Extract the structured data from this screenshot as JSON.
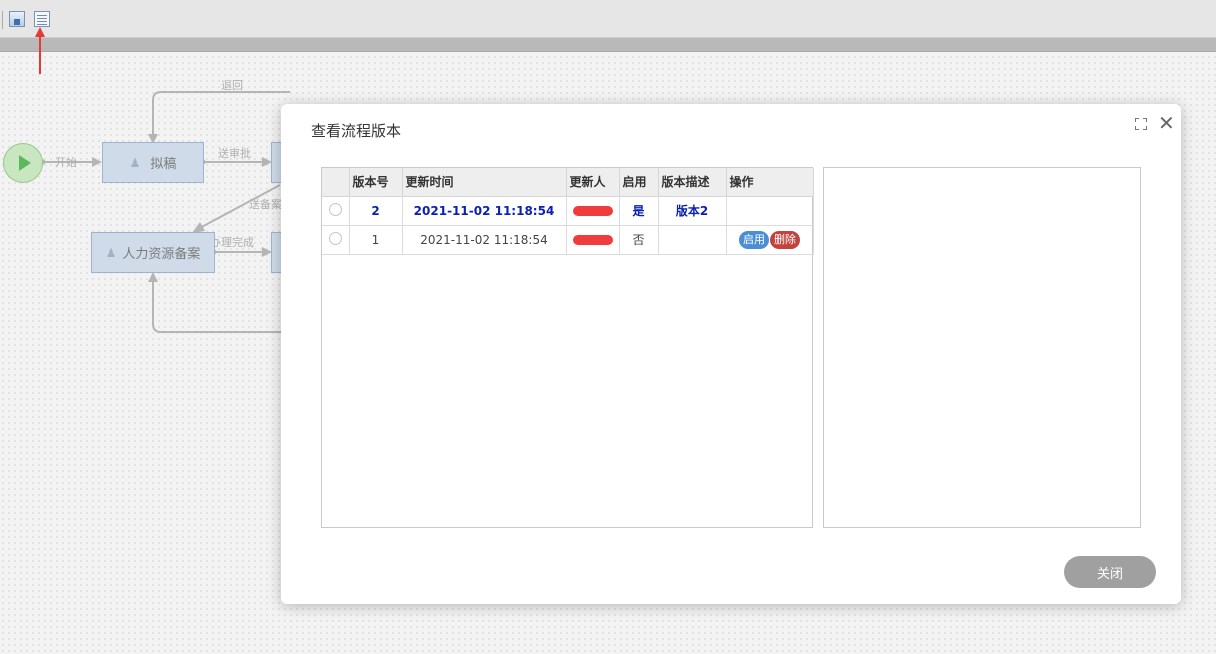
{
  "canvas": {
    "nodes": {
      "draft": "拟稿",
      "hr_filing": "人力资源备案"
    },
    "edge_labels": {
      "return": "退回",
      "start": "开始",
      "send_approval": "送审批",
      "send_filing": "送备案",
      "done": "办理完成"
    }
  },
  "dialog": {
    "title": "查看流程版本",
    "columns": [
      "",
      "版本号",
      "更新时间",
      "更新人",
      "启用",
      "版本描述",
      "操作"
    ],
    "rows": [
      {
        "version": "2",
        "updated": "2021-11-02 11:18:54",
        "enabled": "是",
        "description": "版本2",
        "active": true
      },
      {
        "version": "1",
        "updated": "2021-11-02 11:18:54",
        "enabled": "否",
        "description": "",
        "actions": {
          "enable": "启用",
          "delete": "删除"
        },
        "active": false
      }
    ],
    "close_label": "关闭"
  },
  "colors": {
    "active_row_text": "#0a21b4",
    "enable_button": "#4a8fd6",
    "delete_button": "#c0433f",
    "annotation_arrow": "#e53935"
  }
}
